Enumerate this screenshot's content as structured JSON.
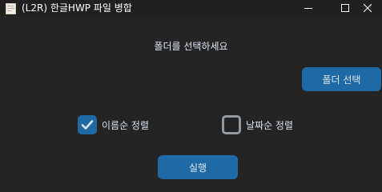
{
  "window": {
    "title": "(L2R) 한글HWP 파일 병합"
  },
  "main": {
    "prompt": "폴더를 선택하세요",
    "folder_button_label": "폴더 선택",
    "sort_by_name_label": "이름순 정렬",
    "sort_by_name_checked": true,
    "sort_by_date_label": "날짜순 정렬",
    "sort_by_date_checked": false,
    "run_button_label": "실행"
  },
  "colors": {
    "background": "#242424",
    "titlebar": "#202020",
    "accent": "#1f6aa5",
    "text": "#dce4ee",
    "checkbox_border": "#949a9f"
  }
}
